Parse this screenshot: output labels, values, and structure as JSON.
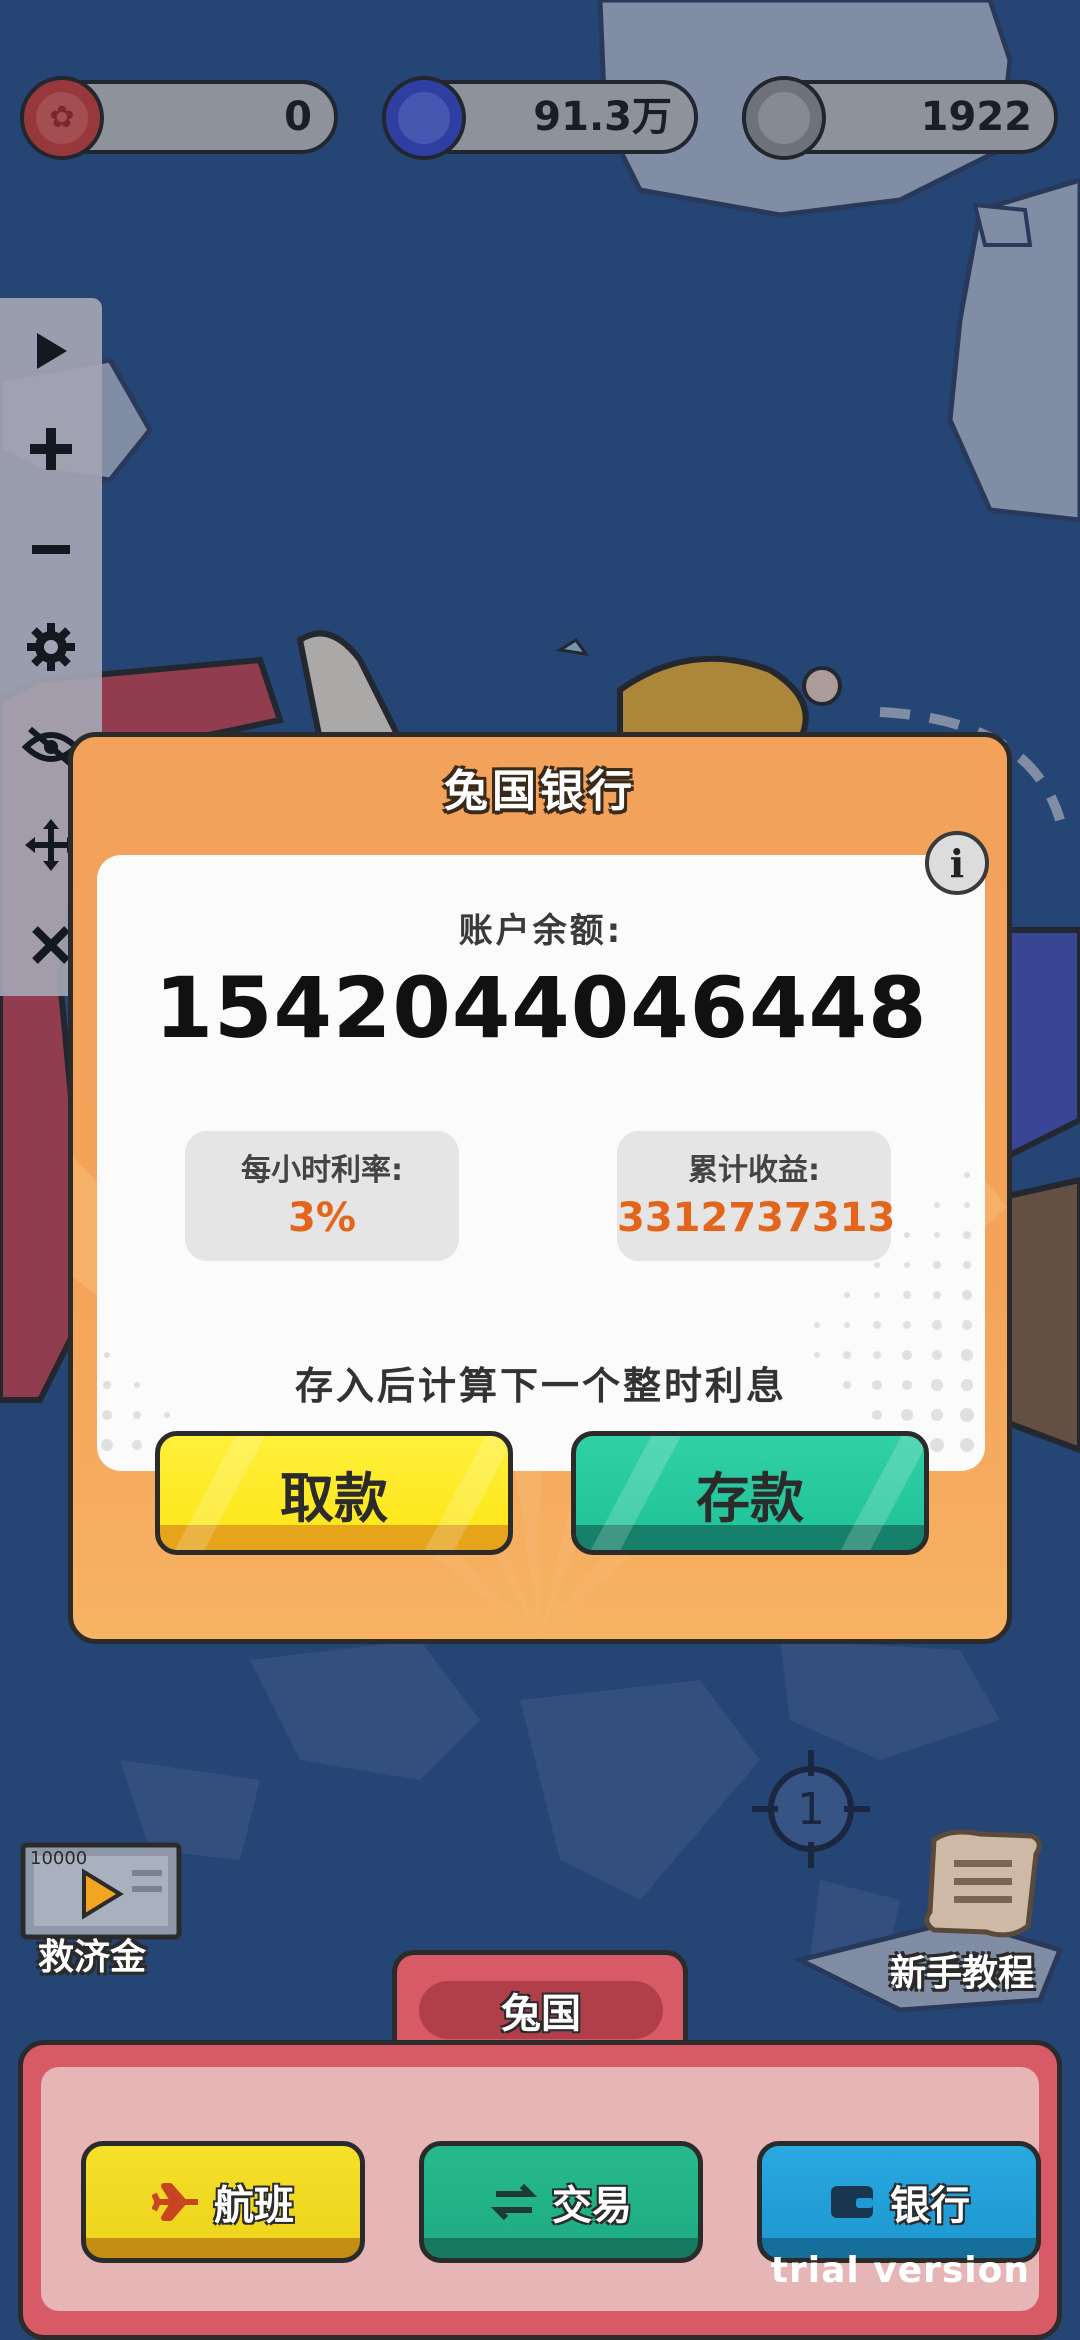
{
  "currencies": [
    {
      "icon": "rabbit-coin-icon",
      "value": "0",
      "color": "#d6453f"
    },
    {
      "icon": "blue-gem-coin-icon",
      "value": "91.3万",
      "color": "#3d4fd1"
    },
    {
      "icon": "grey-shell-coin-icon",
      "value": "1922",
      "color": "#9a9a9a"
    }
  ],
  "toolbar": [
    "play-icon",
    "plus-icon",
    "minus-icon",
    "gear-icon",
    "eye-hidden-icon",
    "move-icon",
    "close-icon"
  ],
  "dialog": {
    "title": "兔国银行",
    "balance_label": "账户余额:",
    "balance_value": "1542044046448",
    "rate_label": "每小时利率:",
    "rate_value": "3%",
    "earnings_label": "累计收益:",
    "earnings_value": "3312737313",
    "hint": "存入后计算下一个整时利息",
    "withdraw_label": "取款",
    "deposit_label": "存款"
  },
  "map": {
    "relief_label": "救济金",
    "relief_amount": "10000",
    "tutorial_label": "新手教程",
    "crosshair_number": "1"
  },
  "bottom": {
    "region_name": "兔国",
    "flight_label": "航班",
    "trade_label": "交易",
    "bank_label": "银行",
    "trial_text": "trial version"
  },
  "colors": {
    "dialog_orange": "#f3a25c",
    "withdraw_yellow": "#fde71e",
    "deposit_teal": "#22c49a",
    "menu_red": "#d85a66"
  }
}
